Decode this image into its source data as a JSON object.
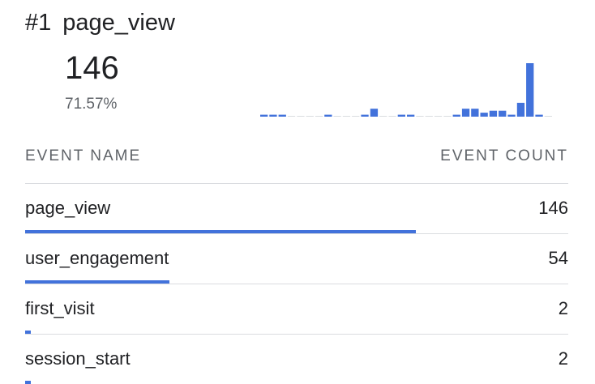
{
  "card": {
    "rank": "#1",
    "event": "page_view",
    "value": "146",
    "percent": "71.57%"
  },
  "table": {
    "columns": {
      "name": "EVENT NAME",
      "count": "EVENT COUNT"
    },
    "rows": [
      {
        "name": "page_view",
        "count": "146",
        "share": 1.0
      },
      {
        "name": "user_engagement",
        "count": "54",
        "share": 0.37
      },
      {
        "name": "first_visit",
        "count": "2",
        "share": 0.014
      },
      {
        "name": "session_start",
        "count": "2",
        "share": 0.014
      }
    ]
  },
  "colors": {
    "accent": "#4272db",
    "baseline": "#dadce0",
    "text": "#202124",
    "muted": "#5f6368"
  },
  "chart_data": {
    "type": "bar",
    "values": [
      1,
      1,
      1,
      0,
      0,
      0,
      0,
      1,
      0,
      0,
      0,
      1,
      4,
      0,
      0,
      1,
      1,
      0,
      0,
      0,
      0,
      1,
      4,
      4,
      2,
      3,
      3,
      1,
      7,
      27,
      1,
      0
    ]
  }
}
